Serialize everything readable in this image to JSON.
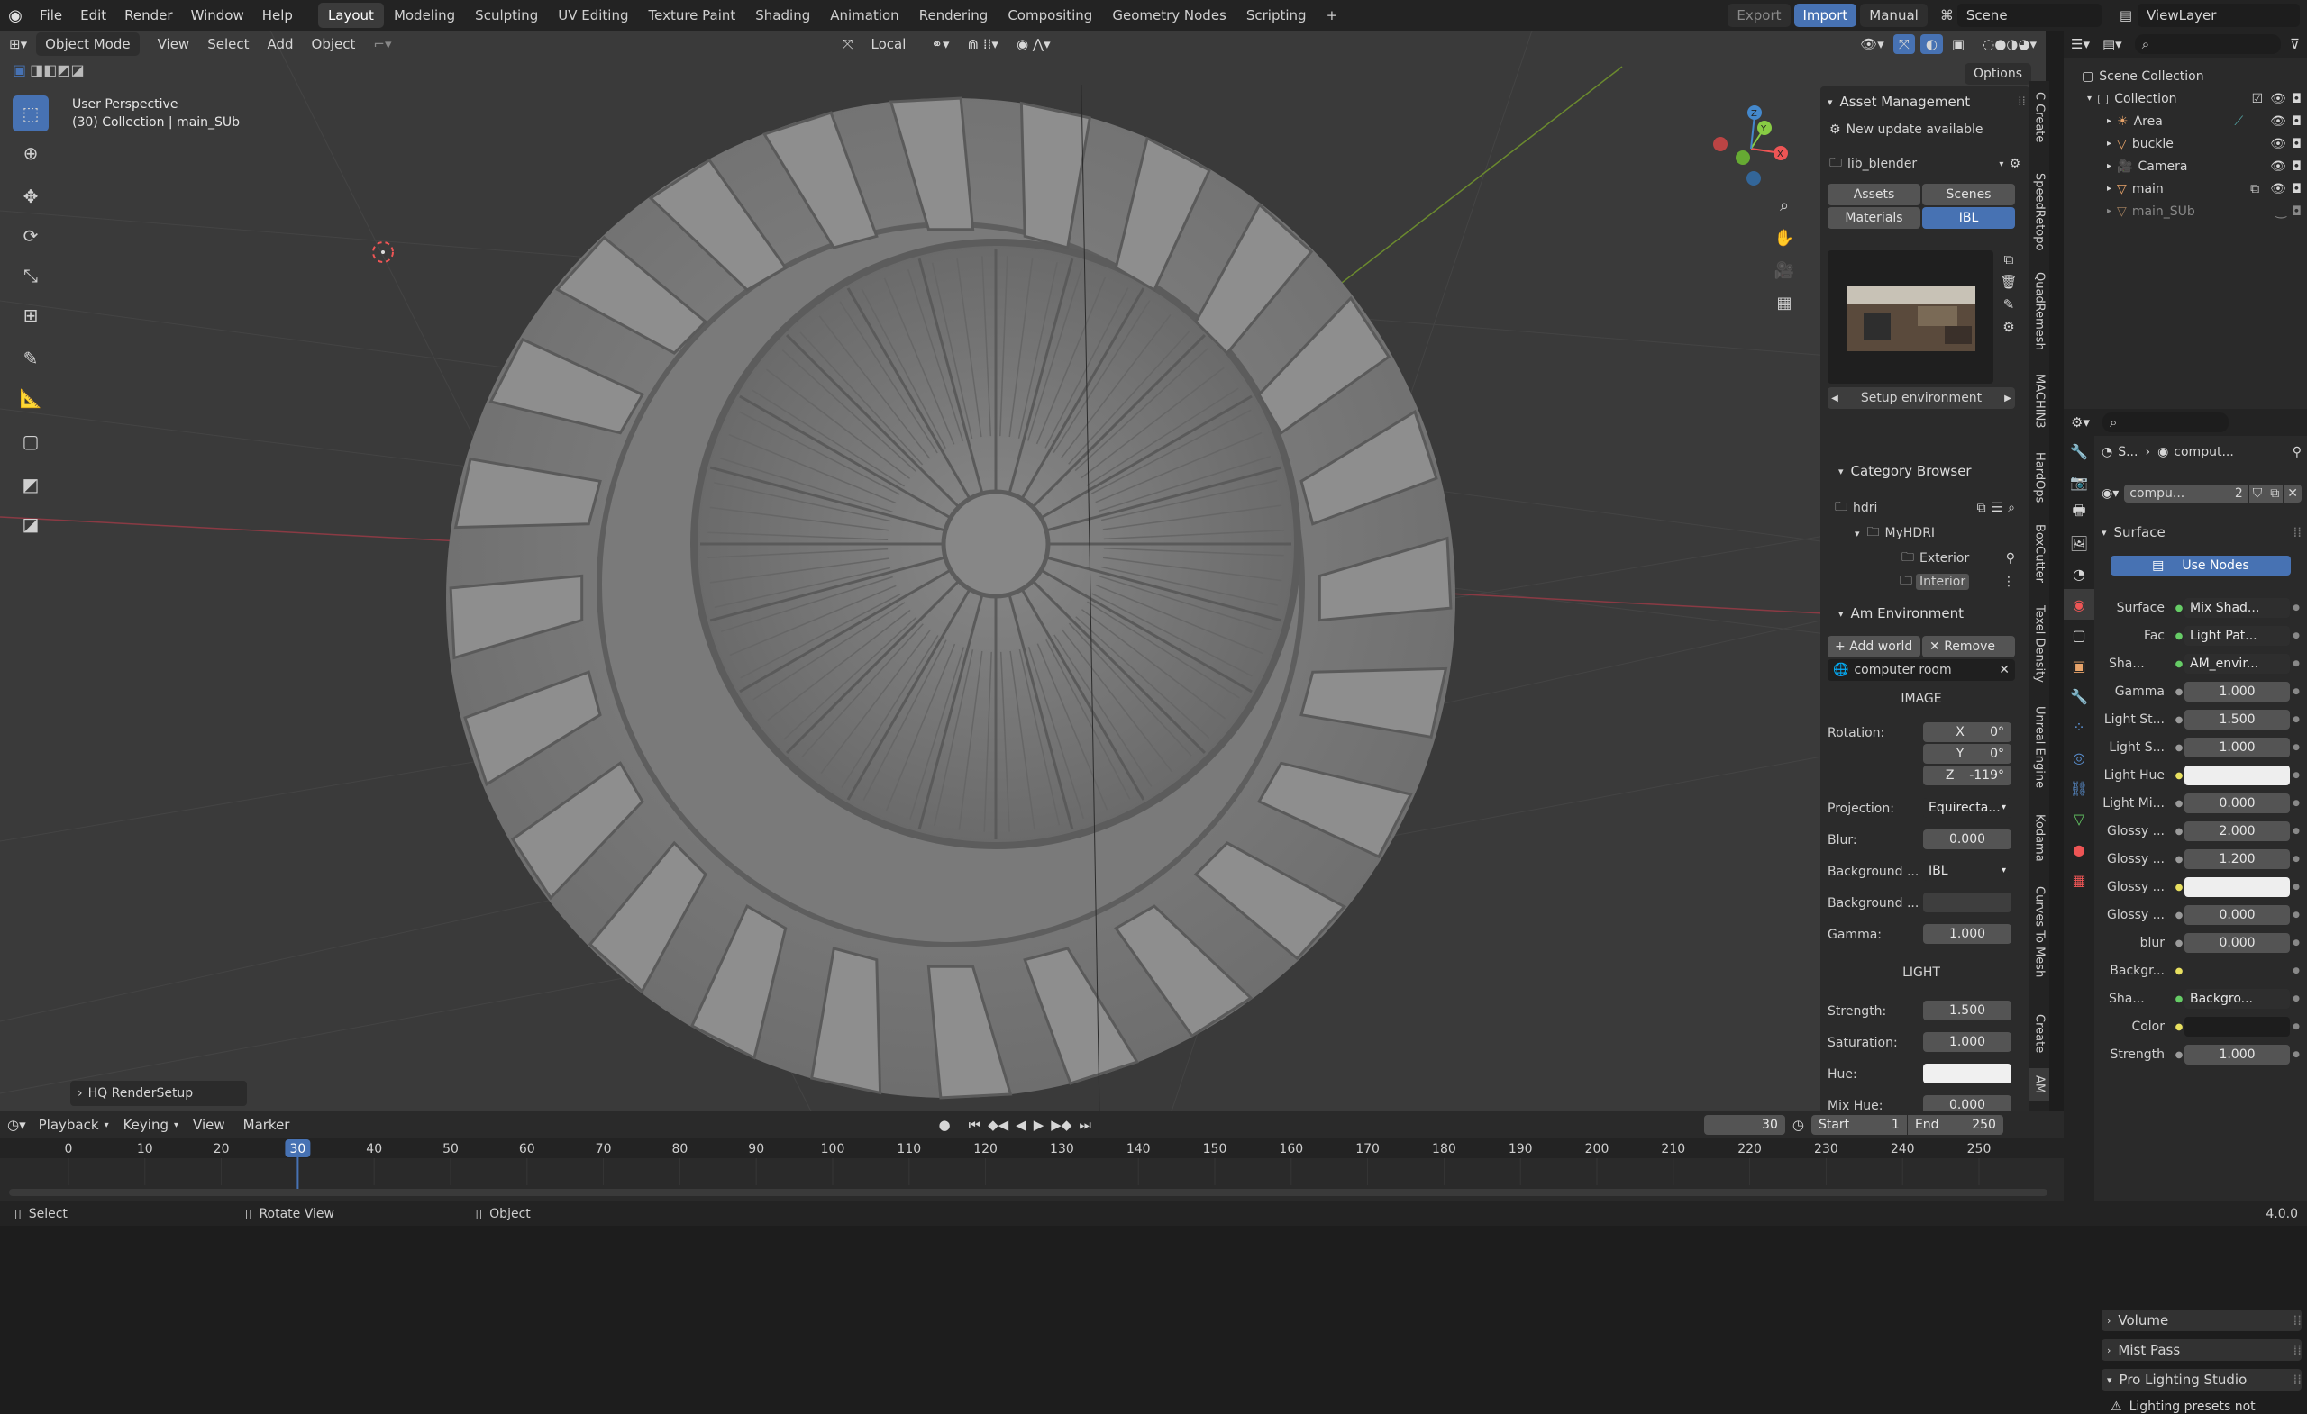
{
  "topbar": {
    "menus": [
      "File",
      "Edit",
      "Render",
      "Window",
      "Help"
    ],
    "workspaces": [
      "Layout",
      "Modeling",
      "Sculpting",
      "UV Editing",
      "Texture Paint",
      "Shading",
      "Animation",
      "Rendering",
      "Compositing",
      "Geometry Nodes",
      "Scripting"
    ],
    "active_workspace": "Layout",
    "add_tab": "+",
    "export_label": "Export",
    "import_label": "Import",
    "manual_label": "Manual",
    "scene": "Scene",
    "view_layer": "ViewLayer"
  },
  "viewport_header": {
    "mode": "Object Mode",
    "menus": [
      "View",
      "Select",
      "Add",
      "Object"
    ],
    "orientation": "Local",
    "options": "Options"
  },
  "viewport": {
    "perspective": "User Perspective",
    "collection": "(30) Collection | main_SUb",
    "operator_panel": "HQ RenderSetup",
    "background_color": "#3a3a3a"
  },
  "asset_panel": {
    "title": "Asset Management",
    "update_notice": "New update available",
    "library": "lib_blender",
    "tabs": [
      "Assets",
      "Scenes",
      "Materials",
      "IBL"
    ],
    "selected_tab": "IBL",
    "setup_environment": "Setup environment",
    "category_browser": "Category Browser",
    "tree": {
      "root": "hdri",
      "group": "MyHDRI",
      "items": [
        "Exterior",
        "Interior"
      ]
    },
    "am_environment": "Am Environment",
    "add_world": "Add world",
    "remove": "Remove",
    "world_name": "computer room",
    "image_header": "IMAGE",
    "rotation_label": "Rotation:",
    "rotation": [
      {
        "axis": "X",
        "value": "0°"
      },
      {
        "axis": "Y",
        "value": "0°"
      },
      {
        "axis": "Z",
        "value": "-119°"
      }
    ],
    "projection_label": "Projection:",
    "projection_value": "Equirecta...",
    "blur_label": "Blur:",
    "blur_value": "0.000",
    "bg_label": "Background ...",
    "bg_value": "IBL",
    "bg2_label": "Background ...",
    "gamma_label": "Gamma:",
    "gamma_value": "1.000",
    "light_header": "LIGHT",
    "strength_label": "Strength:",
    "strength_value": "1.500",
    "saturation_label": "Saturation:",
    "saturation_value": "1.000",
    "hue_label": "Hue:",
    "mixhue_label": "Mix Hue:",
    "mixhue_value": "0.000"
  },
  "vertical_tabs": [
    "C Create",
    "SpeedRetopo",
    "QuadRemesh",
    "MACHIN3",
    "HardOps",
    "BoxCutter",
    "Texel Density",
    "Unreal Engine",
    "Kodama",
    "Curves To Mesh",
    "Create",
    "AM"
  ],
  "outliner": {
    "root": "Scene Collection",
    "collection": "Collection",
    "items": [
      "Area",
      "buckle",
      "Camera",
      "main",
      "main_SUb"
    ]
  },
  "properties": {
    "breadcrumb_a": "S...",
    "breadcrumb_b": "comput...",
    "world_name": "compu...",
    "user_count": "2",
    "surface_header": "Surface",
    "use_nodes": "Use Nodes",
    "rows": [
      {
        "label": "Surface",
        "value": "Mix Shad..."
      },
      {
        "label": "Fac",
        "value": "Light Pat..."
      },
      {
        "label": "Sha...",
        "value": "AM_envir..."
      },
      {
        "label": "Gamma",
        "value": "1.000"
      },
      {
        "label": "Light St...",
        "value": "1.500"
      },
      {
        "label": "Light S...",
        "value": "1.000"
      },
      {
        "label": "Light Hue",
        "value": ""
      },
      {
        "label": "Light Mi...",
        "value": "0.000"
      },
      {
        "label": "Glossy ...",
        "value": "2.000"
      },
      {
        "label": "Glossy ...",
        "value": "1.200"
      },
      {
        "label": "Glossy ...",
        "value": ""
      },
      {
        "label": "Glossy ...",
        "value": "0.000"
      },
      {
        "label": "blur",
        "value": "0.000"
      },
      {
        "label": "Backgr...",
        "value": ""
      },
      {
        "label": "Sha...",
        "value": "Backgro..."
      },
      {
        "label": "Color",
        "value": ""
      },
      {
        "label": "Strength",
        "value": "1.000"
      }
    ],
    "volume": "Volume",
    "mist_pass": "Mist Pass",
    "pro_lighting": "Pro Lighting Studio",
    "warning": "Lighting presets not"
  },
  "timeline": {
    "menus": [
      "Playback",
      "Keying",
      "View",
      "Marker"
    ],
    "current_frame": "30",
    "start_label": "Start",
    "start": "1",
    "end_label": "End",
    "end": "250",
    "ticks": [
      "0",
      "10",
      "20",
      "30",
      "40",
      "50",
      "60",
      "70",
      "80",
      "90",
      "100",
      "110",
      "120",
      "130",
      "140",
      "150",
      "160",
      "170",
      "180",
      "190",
      "200",
      "210",
      "220",
      "230",
      "240",
      "250"
    ]
  },
  "status": {
    "select": "Select",
    "rotate": "Rotate View",
    "object": "Object",
    "version": "4.0.0"
  }
}
